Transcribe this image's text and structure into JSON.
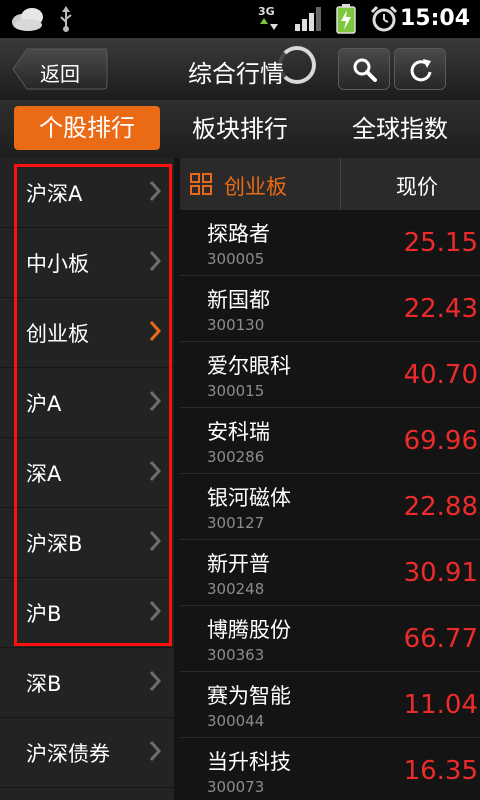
{
  "status_bar": {
    "time": "15:04"
  },
  "header": {
    "back_label": "返回",
    "title": "综合行情"
  },
  "tabs": [
    {
      "label": "个股排行",
      "active": true
    },
    {
      "label": "板块排行",
      "active": false
    },
    {
      "label": "全球指数",
      "active": false
    }
  ],
  "sidebar": {
    "items": [
      {
        "label": "沪深A",
        "selected": false
      },
      {
        "label": "中小板",
        "selected": false
      },
      {
        "label": "创业板",
        "selected": true
      },
      {
        "label": "沪A",
        "selected": false
      },
      {
        "label": "深A",
        "selected": false
      },
      {
        "label": "沪深B",
        "selected": false
      },
      {
        "label": "沪B",
        "selected": false
      },
      {
        "label": "深B",
        "selected": false
      },
      {
        "label": "沪深债券",
        "selected": false
      }
    ]
  },
  "list": {
    "category": "创业板",
    "price_header": "现价",
    "rows": [
      {
        "name": "探路者",
        "code": "300005",
        "price": "25.15"
      },
      {
        "name": "新国都",
        "code": "300130",
        "price": "22.43"
      },
      {
        "name": "爱尔眼科",
        "code": "300015",
        "price": "40.70"
      },
      {
        "name": "安科瑞",
        "code": "300286",
        "price": "69.96"
      },
      {
        "name": "银河磁体",
        "code": "300127",
        "price": "22.88"
      },
      {
        "name": "新开普",
        "code": "300248",
        "price": "30.91"
      },
      {
        "name": "博腾股份",
        "code": "300363",
        "price": "66.77"
      },
      {
        "name": "赛为智能",
        "code": "300044",
        "price": "11.04"
      },
      {
        "name": "当升科技",
        "code": "300073",
        "price": "16.35"
      }
    ]
  },
  "colors": {
    "accent": "#ea6a16",
    "price_up": "#ee2b2b",
    "highlight": "#ff1010"
  }
}
